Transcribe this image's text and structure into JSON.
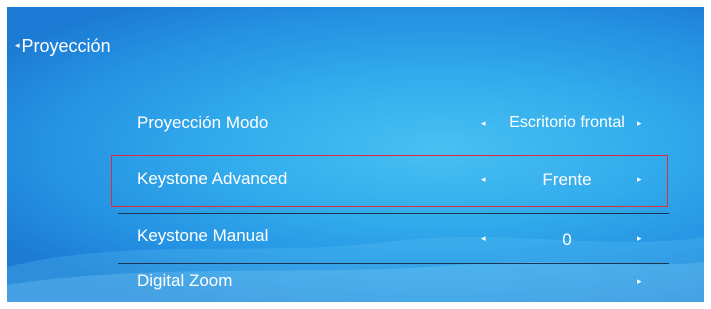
{
  "header": {
    "back_arrow": "◂",
    "title": "Proyección"
  },
  "menu": {
    "items": [
      {
        "label": "Proyección Modo",
        "left_arrow": "◂",
        "value": "Escritorio frontal",
        "right_arrow": "▸"
      },
      {
        "label": "Keystone Advanced",
        "left_arrow": "◂",
        "value": "Frente",
        "right_arrow": "▸"
      },
      {
        "label": "Keystone Manual",
        "left_arrow": "◂",
        "value": "0",
        "right_arrow": "▸"
      },
      {
        "label": "Digital Zoom",
        "right_arrow": "▸"
      }
    ],
    "selected_index": 1
  },
  "colors": {
    "background": "#2e9fe8",
    "text": "#ffffff",
    "highlight": "#d8303a",
    "divider": "#1a3550"
  }
}
